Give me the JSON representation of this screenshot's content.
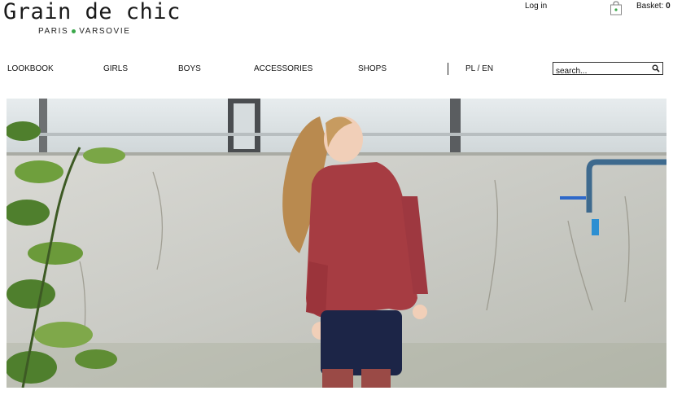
{
  "brand": {
    "title": "Grain de chic",
    "subtitle_left": "PARIS",
    "subtitle_right": "VARSOVIE",
    "dot_color": "#3aa84a"
  },
  "header": {
    "login_label": "Log in",
    "basket_label": "Basket:",
    "basket_count": "0",
    "basket_icon": "shopping-bag-icon"
  },
  "nav": {
    "items": [
      "LOOKBOOK",
      "GIRLS",
      "BOYS",
      "ACCESSORIES",
      "SHOPS"
    ],
    "language": "PL / EN"
  },
  "search": {
    "placeholder": "search...",
    "icon": "search-icon"
  },
  "hero": {
    "description_icon": "hero-photo"
  },
  "colors": {
    "text": "#111111",
    "background": "#ffffff"
  }
}
